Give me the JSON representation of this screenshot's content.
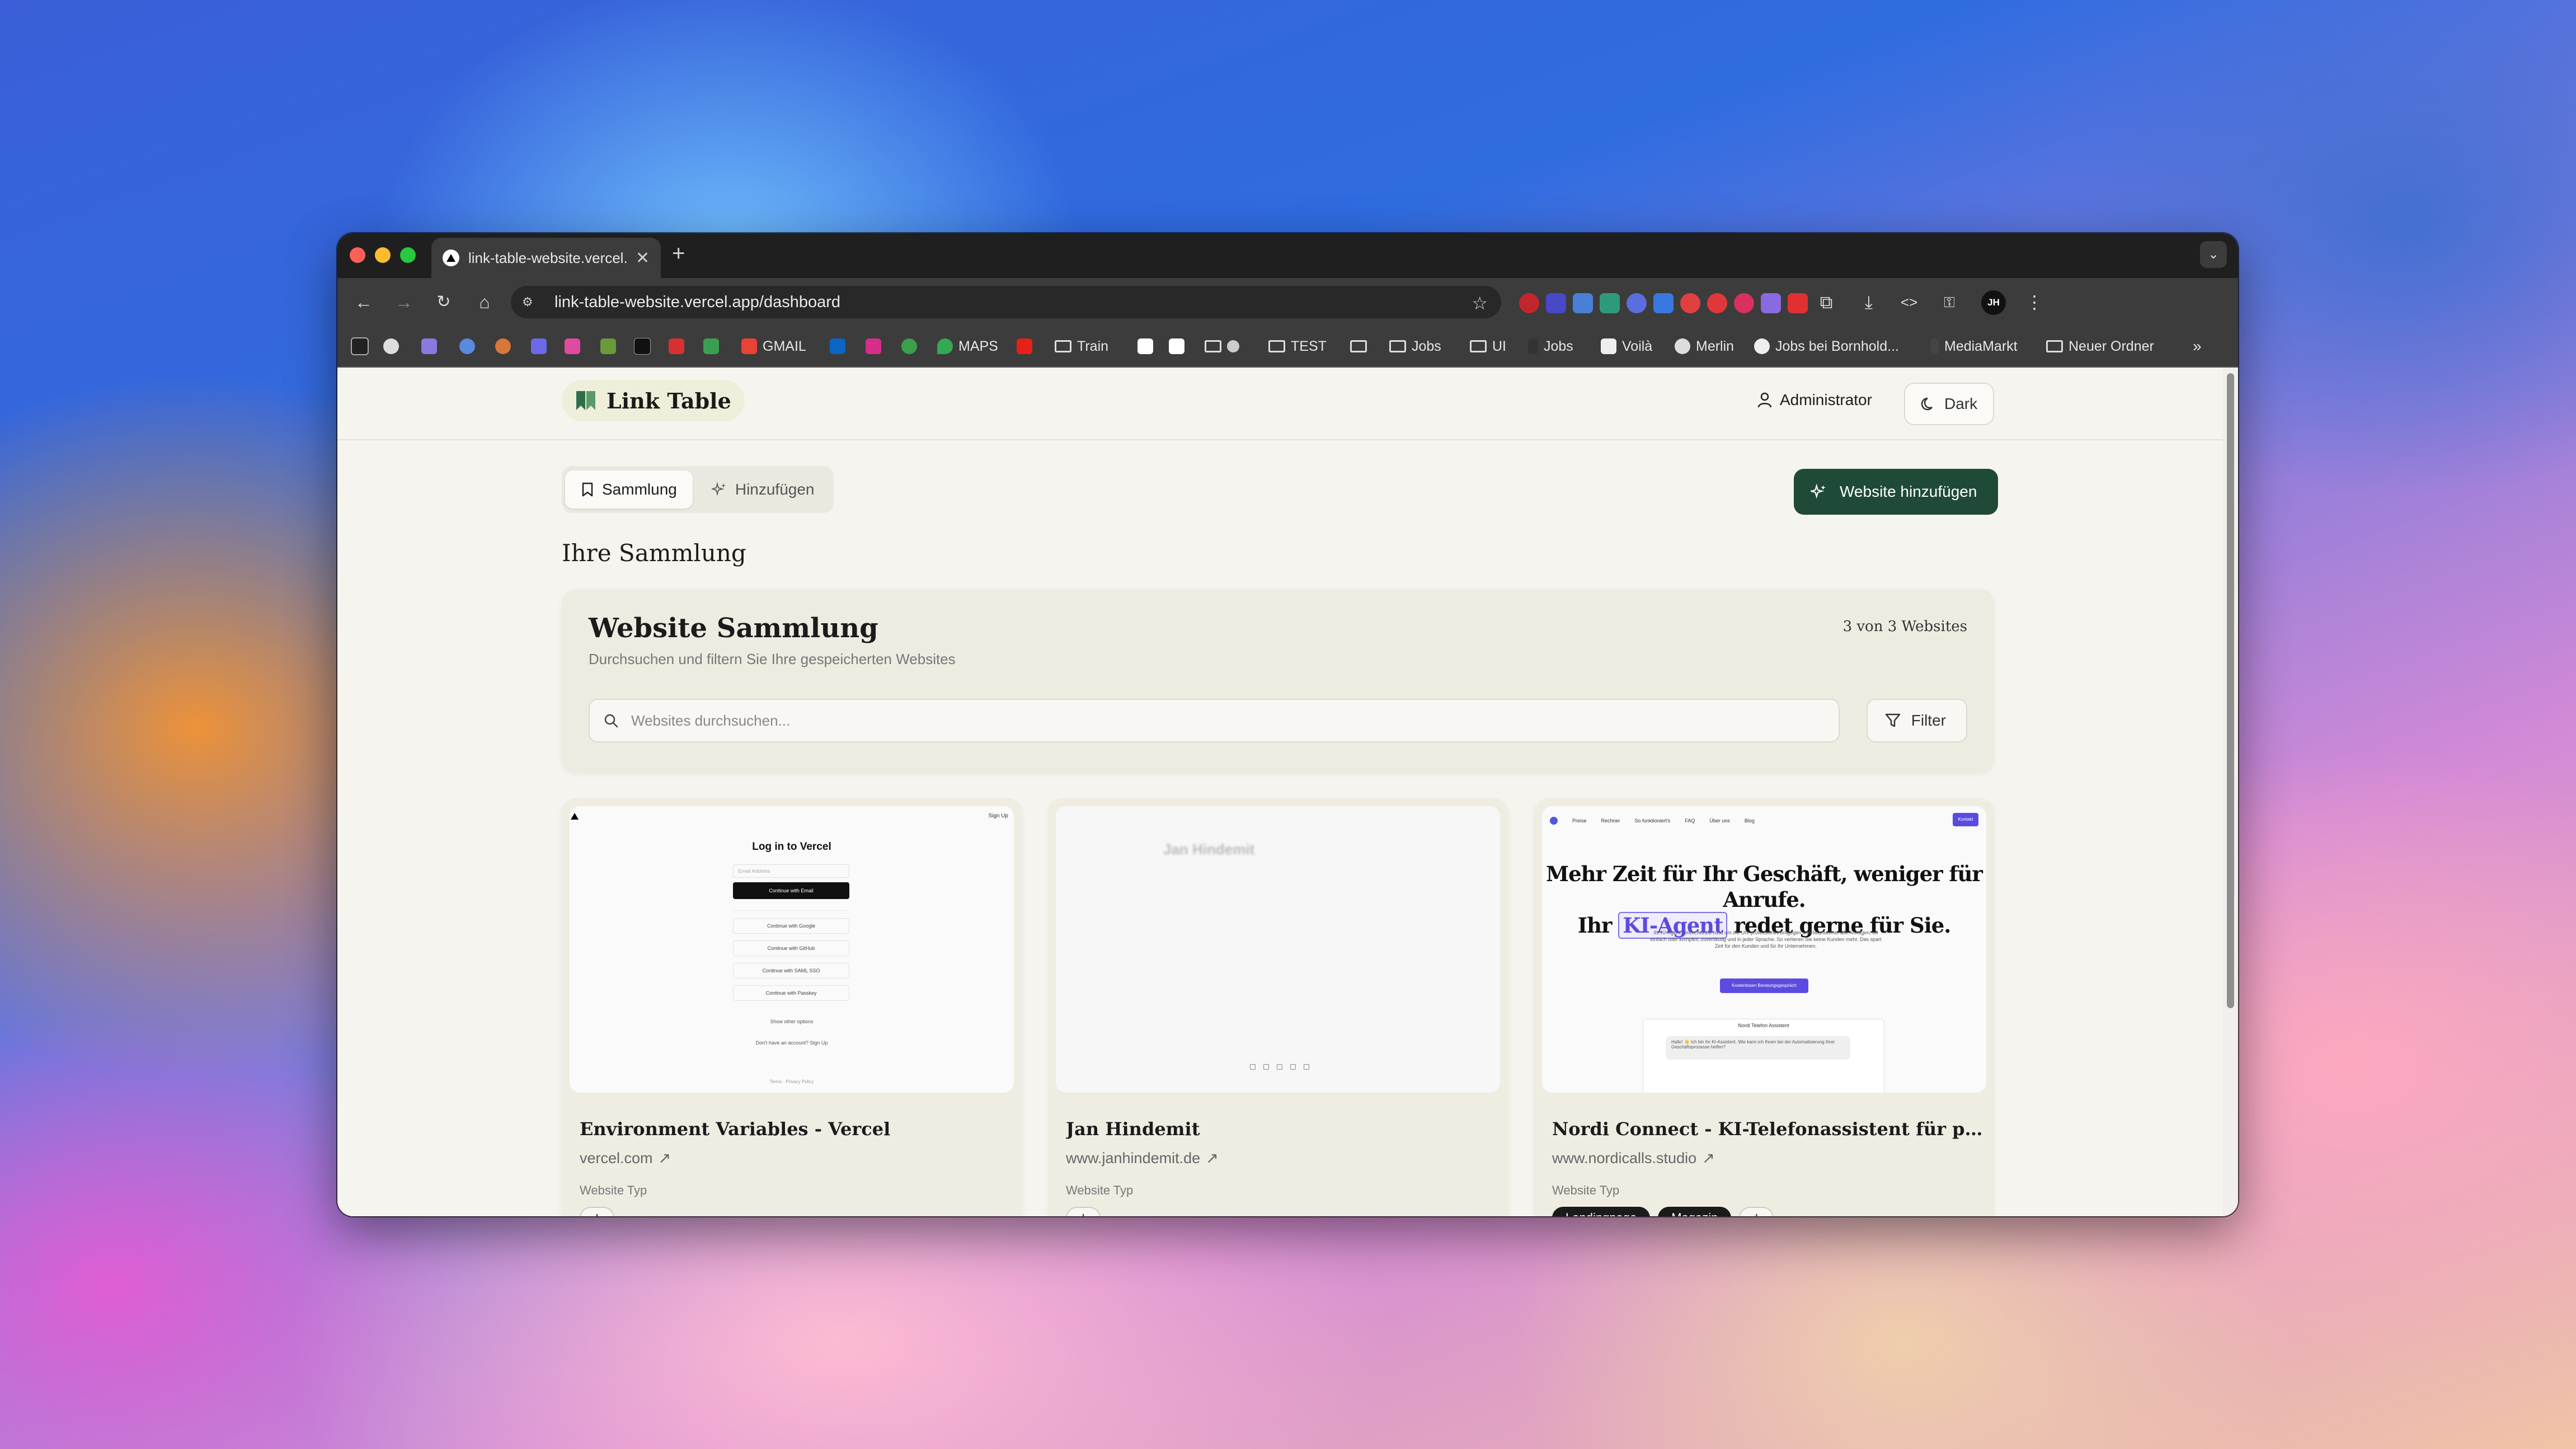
{
  "browser": {
    "tab_title": "link-table-website.vercel.app",
    "url": "link-table-website.vercel.app/dashboard",
    "profile_initials": "JH",
    "bookmarks": [
      {
        "label": "GMAIL",
        "icon": "gmail-icon",
        "color": "#ea4335"
      },
      {
        "label": "MAPS",
        "icon": "maps-icon",
        "color": "#34a853"
      },
      {
        "label": "Train",
        "icon": "folder-icon"
      },
      {
        "label": "TEST",
        "icon": "folder-icon"
      },
      {
        "label": "Jobs",
        "icon": "folder-icon"
      },
      {
        "label": "UI",
        "icon": "folder-icon"
      },
      {
        "label": "Jobs",
        "icon": "jobs-icon"
      },
      {
        "label": "Voilà",
        "icon": "voila-icon"
      },
      {
        "label": "Merlin",
        "icon": "merlin-icon"
      },
      {
        "label": "Jobs bei Bornhold...",
        "icon": "bornhold-icon"
      },
      {
        "label": "MediaMarkt",
        "icon": "mediamarkt-icon"
      },
      {
        "label": "Neuer Ordner",
        "icon": "folder-icon"
      }
    ]
  },
  "header": {
    "logo_text": "Link Table",
    "user_label": "Administrator",
    "theme_label": "Dark"
  },
  "tabs": [
    {
      "label": "Sammlung",
      "active": true
    },
    {
      "label": "Hinzufügen",
      "active": false
    }
  ],
  "add_button_label": "Website hinzufügen",
  "section_title": "Ihre Sammlung",
  "collection": {
    "title": "Website Sammlung",
    "subtitle": "Durchsuchen und filtern Sie Ihre gespeicherten Websites",
    "count": "3 von 3 Websites",
    "search_placeholder": "Websites durchsuchen...",
    "filter_label": "Filter"
  },
  "type_label": "Website Typ",
  "cards": [
    {
      "title": "Environment Variables - Vercel",
      "domain": "vercel.com",
      "tags": [],
      "thumb": {
        "sign_up": "Sign Up",
        "heading": "Log in to Vercel",
        "email_placeholder": "Email Address",
        "continue_email": "Continue with Email",
        "google": "Continue with Google",
        "github": "Continue with GitHub",
        "saml": "Continue with SAML SSO",
        "passkey": "Continue with Passkey",
        "other": "Show other options",
        "no_account": "Don't have an account? Sign Up",
        "footer": "Terms · Privacy Policy"
      }
    },
    {
      "title": "Jan Hindemit",
      "domain": "www.janhindemit.de",
      "tags": [],
      "thumb": {
        "name": "Jan Hindemit"
      }
    },
    {
      "title": "Nordi Connect - KI-Telefonassistent für profes...",
      "domain": "www.nordicalls.studio",
      "tags": [
        "Landingpage",
        "Magazin"
      ],
      "thumb": {
        "nav": [
          "Preise",
          "Rechner",
          "So funktioniert's",
          "FAQ",
          "Über uns",
          "Blog"
        ],
        "cta": "Kontakt",
        "headline_line1": "Mehr Zeit für Ihr Geschäft, weniger für Anrufe.",
        "headline_pre": "Ihr",
        "headline_highlight": "KI-Agent",
        "headline_post": "redet gerne für Sie.",
        "paragraph": "Ihr KI-Agent nimmt Anrufe rund um die Uhr professionell entgegen und beantwortet alle Anfragen, ob einfach oder komplex, zuverlässig und in jeder Sprache. So verlieren Sie keine Kunden mehr. Das spart Zeit für den Kunden und für Ihr Unternehmen.",
        "button": "Kostenlosen Beratungsgespräch",
        "mock_title": "Nordi Telefon Assistent",
        "mock_bubble": "Hallo! 👋 Ich bin Ihr KI-Assistent. Wie kann ich Ihnen bei der Automatisierung Ihrer Geschäftsprozesse helfen?"
      }
    }
  ]
}
